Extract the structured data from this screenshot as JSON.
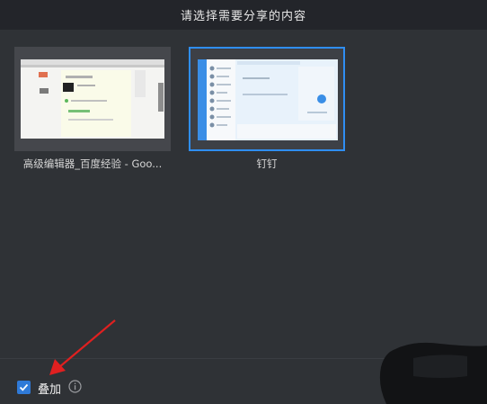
{
  "header": {
    "title": "请选择需要分享的内容"
  },
  "windows": [
    {
      "label": "高级编辑器_百度经验 - Goo...",
      "selected": false,
      "icon": "browser-window-thumbnail"
    },
    {
      "label": "钉钉",
      "selected": true,
      "icon": "dingtalk-window-thumbnail"
    }
  ],
  "footer": {
    "overlay_label": "叠加",
    "overlay_checked": true,
    "info_icon": "info-icon"
  },
  "colors": {
    "accent": "#2f8ef3",
    "background": "#2f3236",
    "titlebar": "#23252a",
    "annotation_arrow": "#e02020"
  }
}
